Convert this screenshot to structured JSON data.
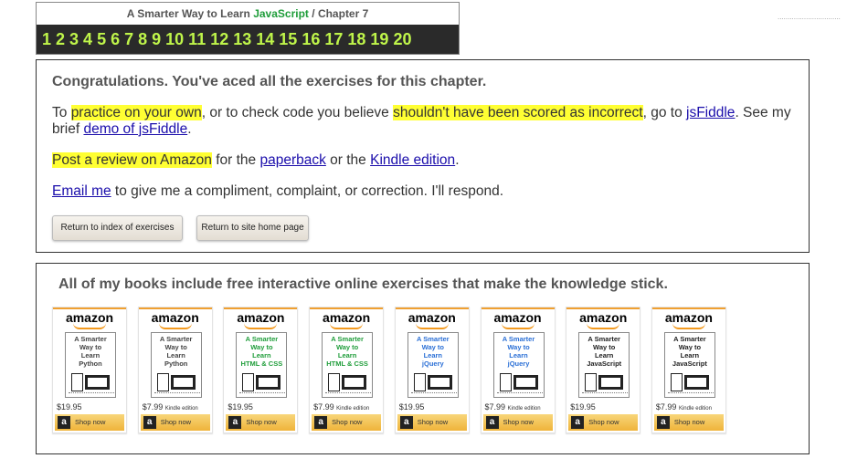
{
  "header": {
    "title_prefix": "A Smarter Way to Learn",
    "title_lang": "JavaScript",
    "title_sep": "/",
    "title_chapter": "Chapter 7",
    "chapters": [
      "1",
      "2",
      "3",
      "4",
      "5",
      "6",
      "7",
      "8",
      "9",
      "10",
      "11",
      "12",
      "13",
      "14",
      "15",
      "16",
      "17",
      "18",
      "19",
      "20"
    ],
    "chapter_color": "#bff54a",
    "lang_color": "#1f9d3a"
  },
  "dots": "...............................",
  "congrats": {
    "heading": "Congratulations. You've aced all the exercises for this chapter.",
    "p1_a": "To ",
    "p1_hl1": "practice on your own",
    "p1_b": ", or to check code you believe ",
    "p1_hl2": "shouldn't have been scored as incorrect",
    "p1_c": ", go to ",
    "p1_link1": "jsFiddle",
    "p1_d": ". See my brief ",
    "p1_link2": "demo of jsFiddle",
    "p1_e": ".",
    "p2_hl": "Post a review on Amazon",
    "p2_a": " for the ",
    "p2_link1": "paperback",
    "p2_b": " or the ",
    "p2_link2": "Kindle edition",
    "p2_c": ".",
    "p3_link": "Email me",
    "p3_a": " to give me a compliment, complaint, or correction. I'll respond.",
    "btn_index": "Return to index of exercises",
    "btn_home": "Return to site home page",
    "highlight_color": "#ffff33",
    "link_color": "#1a0dab"
  },
  "books": {
    "heading": "All of my books include free interactive online exercises that make the knowledge stick.",
    "logo_text": "amazon",
    "shop_label": "Shop now",
    "items": [
      {
        "line1": "A Smarter",
        "line2": "Way to",
        "line3": "Learn",
        "line4": "Python",
        "price": "$19.95",
        "edition": "",
        "title_color": "#444"
      },
      {
        "line1": "A Smarter",
        "line2": "Way to",
        "line3": "Learn",
        "line4": "Python",
        "price": "$7.99",
        "edition": "Kindle edition",
        "title_color": "#444"
      },
      {
        "line1": "A Smarter",
        "line2": "Way to",
        "line3": "Learn",
        "line4": "HTML & CSS",
        "price": "$19.95",
        "edition": "",
        "title_color": "#1f9d3a"
      },
      {
        "line1": "A Smarter",
        "line2": "Way to",
        "line3": "Learn",
        "line4": "HTML & CSS",
        "price": "$7.99",
        "edition": "Kindle edition",
        "title_color": "#1f9d3a"
      },
      {
        "line1": "A Smarter",
        "line2": "Way to",
        "line3": "Learn",
        "line4": "jQuery",
        "price": "$19.95",
        "edition": "",
        "title_color": "#2a6fd6"
      },
      {
        "line1": "A Smarter",
        "line2": "Way to",
        "line3": "Learn",
        "line4": "jQuery",
        "price": "$7.99",
        "edition": "Kindle edition",
        "title_color": "#2a6fd6"
      },
      {
        "line1": "A Smarter",
        "line2": "Way to",
        "line3": "Learn",
        "line4": "JavaScript",
        "price": "$19.95",
        "edition": "",
        "title_color": "#222"
      },
      {
        "line1": "A Smarter",
        "line2": "Way to",
        "line3": "Learn",
        "line4": "JavaScript",
        "price": "$7.99",
        "edition": "Kindle edition",
        "title_color": "#222"
      }
    ]
  }
}
